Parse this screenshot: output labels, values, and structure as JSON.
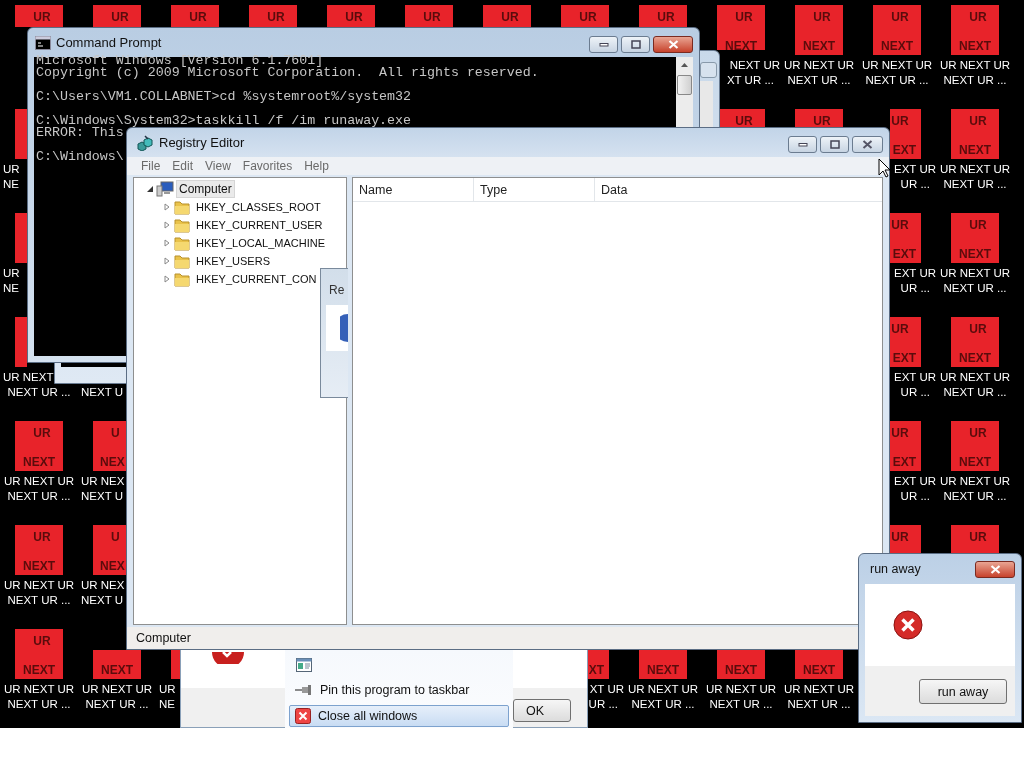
{
  "desktop": {
    "rows": [
      {
        "icons": [
          {
            "kind": "icon",
            "top": "UR"
          },
          {
            "kind": "icon",
            "top": "UR"
          },
          {
            "kind": "icon",
            "top": "UR"
          },
          {
            "kind": "icon",
            "top": "UR"
          },
          {
            "kind": "icon",
            "top": "UR"
          },
          {
            "kind": "icon",
            "top": "UR"
          },
          {
            "kind": "icon",
            "top": "UR"
          },
          {
            "kind": "icon",
            "top": "UR"
          },
          {
            "kind": "icon",
            "top": "UR"
          },
          {
            "kind": "icon",
            "top": "UR",
            "bottom": "NEXT",
            "line1_tail": "NEXT UR",
            "line2_tail": "XT UR ..."
          },
          {
            "kind": "icon",
            "top": "UR",
            "bottom": "NEXT",
            "line1": "UR NEXT UR",
            "line2": "NEXT UR ..."
          },
          {
            "kind": "icon",
            "top": "UR",
            "bottom": "NEXT",
            "line1": "UR NEXT UR",
            "line2": "NEXT UR ..."
          },
          {
            "kind": "icon",
            "top": "UR",
            "bottom": "NEXT",
            "line1": "UR NEXT UR",
            "line2": "NEXT UR ..."
          }
        ]
      },
      {
        "icons": [
          {
            "kind": "icon",
            "line1_head": "UR",
            "line2_head": "NE"
          },
          {
            "kind": "covered"
          },
          {
            "kind": "covered"
          },
          {
            "kind": "covered"
          },
          {
            "kind": "covered"
          },
          {
            "kind": "covered"
          },
          {
            "kind": "covered"
          },
          {
            "kind": "covered"
          },
          {
            "kind": "covered"
          },
          {
            "kind": "icon",
            "top": "UR"
          },
          {
            "kind": "icon",
            "top": "UR"
          },
          {
            "kind": "icon",
            "top": "UR",
            "bottom_tail": "EXT",
            "line1_tail": "EXT UR",
            "line2_tail": "UR ..."
          },
          {
            "kind": "icon",
            "top": "UR",
            "bottom": "NEXT",
            "line1": "UR NEXT UR",
            "line2": "NEXT UR ..."
          }
        ]
      },
      {
        "icons": [
          {
            "kind": "icon",
            "line1_head": "UR",
            "line2_head": "NE"
          },
          {
            "kind": "covered"
          },
          {
            "kind": "covered"
          },
          {
            "kind": "covered"
          },
          {
            "kind": "covered"
          },
          {
            "kind": "covered"
          },
          {
            "kind": "covered"
          },
          {
            "kind": "covered"
          },
          {
            "kind": "covered"
          },
          {
            "kind": "covered"
          },
          {
            "kind": "covered"
          },
          {
            "kind": "icon",
            "top": "UR",
            "bottom_tail": "EXT",
            "line1_tail": "EXT UR",
            "line2_tail": "UR ..."
          },
          {
            "kind": "icon",
            "top": "UR",
            "bottom": "NEXT",
            "line1": "UR NEXT UR",
            "line2": "NEXT UR ..."
          }
        ]
      },
      {
        "icons": [
          {
            "kind": "icon",
            "line1_head": "UR NEXT",
            "line2": "NEXT UR ..."
          },
          {
            "kind": "label_only",
            "line2_head": "NEXT U"
          },
          {
            "kind": "covered"
          },
          {
            "kind": "covered"
          },
          {
            "kind": "covered"
          },
          {
            "kind": "covered"
          },
          {
            "kind": "covered"
          },
          {
            "kind": "covered"
          },
          {
            "kind": "covered"
          },
          {
            "kind": "covered"
          },
          {
            "kind": "covered"
          },
          {
            "kind": "icon",
            "top": "UR",
            "bottom_tail": "EXT",
            "line1_tail": "EXT UR",
            "line2_tail": "UR ..."
          },
          {
            "kind": "icon",
            "top": "UR",
            "bottom": "NEXT",
            "line1": "UR NEXT UR",
            "line2": "NEXT UR ..."
          }
        ]
      },
      {
        "icons": [
          {
            "kind": "icon",
            "top": "UR",
            "bottom": "NEXT",
            "line1": "UR NEXT UR",
            "line2": "NEXT UR ..."
          },
          {
            "kind": "icon",
            "top_head": "U",
            "bottom_head": "NEX",
            "line1_head": "UR NEX",
            "line2_head": "NEXT U"
          },
          {
            "kind": "covered"
          },
          {
            "kind": "covered"
          },
          {
            "kind": "covered"
          },
          {
            "kind": "covered"
          },
          {
            "kind": "covered"
          },
          {
            "kind": "covered"
          },
          {
            "kind": "covered"
          },
          {
            "kind": "covered"
          },
          {
            "kind": "covered"
          },
          {
            "kind": "icon",
            "top": "UR",
            "bottom_tail": "EXT",
            "line1_tail": "EXT UR",
            "line2_tail": "UR ..."
          },
          {
            "kind": "icon",
            "top": "UR",
            "bottom": "NEXT",
            "line1": "UR NEXT UR",
            "line2": "NEXT UR ..."
          }
        ]
      },
      {
        "icons": [
          {
            "kind": "icon",
            "top": "UR",
            "bottom": "NEXT",
            "line1": "UR NEXT UR",
            "line2": "NEXT UR ..."
          },
          {
            "kind": "icon",
            "top_head": "U",
            "bottom_head": "NEX",
            "line1_head": "UR NEX",
            "line2_head": "NEXT U"
          },
          {
            "kind": "covered"
          },
          {
            "kind": "covered"
          },
          {
            "kind": "covered"
          },
          {
            "kind": "covered"
          },
          {
            "kind": "covered"
          },
          {
            "kind": "covered"
          },
          {
            "kind": "covered"
          },
          {
            "kind": "covered"
          },
          {
            "kind": "covered"
          },
          {
            "kind": "icon",
            "top": "UR"
          },
          {
            "kind": "icon",
            "top": "UR"
          }
        ]
      },
      {
        "icons": [
          {
            "kind": "icon",
            "top": "UR",
            "bottom": "NEXT",
            "line1": "UR NEXT UR",
            "line2": "NEXT UR ..."
          },
          {
            "kind": "icon",
            "bottom": "NEXT",
            "line1": "UR NEXT UR",
            "line2": "NEXT UR ..."
          },
          {
            "kind": "icon",
            "line1_head": "UR",
            "line2_head": "NE"
          },
          {
            "kind": "covered"
          },
          {
            "kind": "covered"
          },
          {
            "kind": "covered"
          },
          {
            "kind": "covered"
          },
          {
            "kind": "icon",
            "bottom_tail": "XT",
            "line1_tail": "XT UR",
            "line2_tail": "UR ..."
          },
          {
            "kind": "icon",
            "bottom": "NEXT",
            "line1": "UR NEXT UR",
            "line2": "NEXT UR ..."
          },
          {
            "kind": "icon",
            "bottom": "NEXT",
            "line1": "UR NEXT UR",
            "line2": "NEXT UR ..."
          },
          {
            "kind": "icon",
            "bottom": "NEXT",
            "line1": "UR NEXT UR",
            "line2": "NEXT UR ..."
          },
          {
            "kind": "covered"
          },
          {
            "kind": "covered"
          }
        ]
      }
    ]
  },
  "command_prompt": {
    "title": "Command Prompt",
    "blocks": [
      [
        "Microsoft Windows [Version 6.1.7601]",
        "Copyright (c) 2009 Microsoft Corporation.  All rights reserved."
      ],
      [
        "C:\\Users\\VM1.COLLABNET>cd %systemroot%/system32"
      ],
      [
        "C:\\Windows\\System32>taskkill /f /im runaway.exe",
        "ERROR: This"
      ],
      [
        "C:\\Windows\\"
      ]
    ]
  },
  "registry_editor": {
    "title": "Registry Editor",
    "menu": [
      "File",
      "Edit",
      "View",
      "Favorites",
      "Help"
    ],
    "tree": [
      {
        "label": "Computer",
        "expanded": true,
        "selected": true,
        "children": [
          {
            "label": "HKEY_CLASSES_ROOT",
            "expanded": false,
            "selected": false
          },
          {
            "label": "HKEY_CURRENT_USER",
            "expanded": false,
            "selected": false
          },
          {
            "label": "HKEY_LOCAL_MACHINE",
            "expanded": false,
            "selected": false
          },
          {
            "label": "HKEY_USERS",
            "expanded": false,
            "selected": false
          },
          {
            "label": "HKEY_CURRENT_CON",
            "expanded": false,
            "selected": false
          }
        ]
      }
    ],
    "columns": [
      "Name",
      "Type",
      "Data"
    ],
    "status_bar": "Computer"
  },
  "hidden_dialog": {
    "title": "Re"
  },
  "error_dialog": {
    "ok_button": "OK"
  },
  "jump_list": {
    "items": [
      {
        "kind": "app",
        "selected": false
      },
      {
        "kind": "pin",
        "label": "Pin this program to taskbar",
        "selected": false
      },
      {
        "kind": "close",
        "label": "Close all windows",
        "selected": true
      }
    ]
  },
  "run_away_dialog": {
    "title": "run away",
    "button": "run away"
  }
}
